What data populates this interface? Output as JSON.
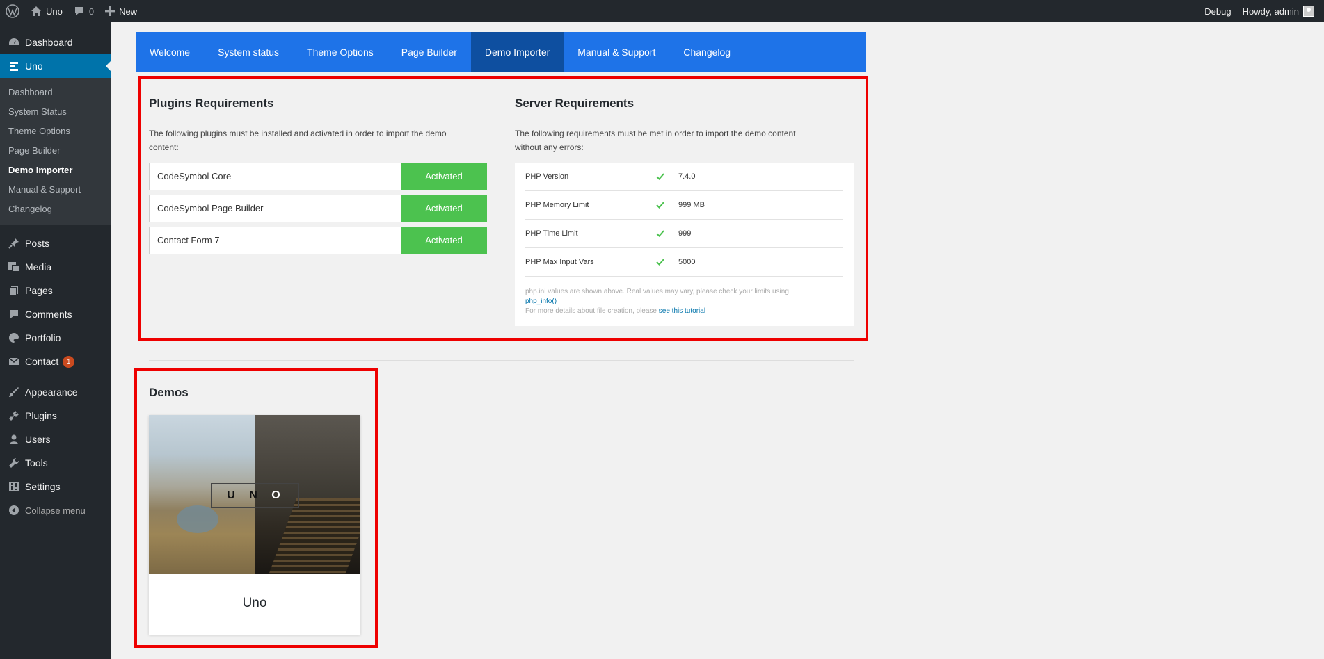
{
  "adminbar": {
    "site_name": "Uno",
    "comments_count": "0",
    "new_label": "New",
    "debug_label": "Debug",
    "howdy_label": "Howdy, admin"
  },
  "sidebar": {
    "dashboard": "Dashboard",
    "uno": "Uno",
    "submenu": [
      "Dashboard",
      "System Status",
      "Theme Options",
      "Page Builder",
      "Demo Importer",
      "Manual & Support",
      "Changelog"
    ],
    "posts": "Posts",
    "media": "Media",
    "pages": "Pages",
    "comments": "Comments",
    "portfolio": "Portfolio",
    "contact": "Contact",
    "contact_badge": "1",
    "appearance": "Appearance",
    "plugins": "Plugins",
    "users": "Users",
    "tools": "Tools",
    "settings": "Settings",
    "collapse": "Collapse menu"
  },
  "tabs": [
    "Welcome",
    "System status",
    "Theme Options",
    "Page Builder",
    "Demo Importer",
    "Manual & Support",
    "Changelog"
  ],
  "plugins": {
    "title": "Plugins Requirements",
    "desc_line1": "The following plugins must be installed and activated in order to import the demo",
    "desc_line2": "content:",
    "rows": [
      {
        "name": "CodeSymbol Core",
        "status": "Activated"
      },
      {
        "name": "CodeSymbol Page Builder",
        "status": "Activated"
      },
      {
        "name": "Contact Form 7",
        "status": "Activated"
      }
    ]
  },
  "server": {
    "title": "Server Requirements",
    "desc_line1": "The following requirements must be met in order to import the demo content",
    "desc_line2": "without any errors:",
    "rows": [
      {
        "label": "PHP Version",
        "value": "7.4.0"
      },
      {
        "label": "PHP Memory Limit",
        "value": "999 MB"
      },
      {
        "label": "PHP Time Limit",
        "value": "999"
      },
      {
        "label": "PHP Max Input Vars",
        "value": "5000"
      }
    ],
    "note_line1": "php.ini values are shown above. Real values may vary, please check your limits using",
    "note_link1": "php_info()",
    "note_line2": "For more details about file creation, please",
    "note_link2": "see this tutorial",
    "check_color": "#4cc24f"
  },
  "demos": {
    "title": "Demos",
    "logo_letters": [
      "U",
      "N",
      "O"
    ],
    "items": [
      {
        "name": "Uno"
      }
    ]
  }
}
